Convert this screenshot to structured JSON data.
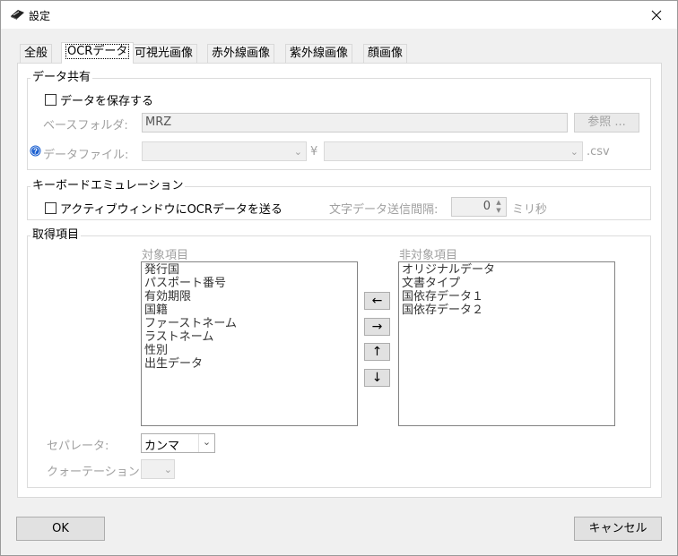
{
  "window": {
    "title": "設定"
  },
  "tabs": [
    "全般",
    "OCRデータ",
    "可視光画像",
    "赤外線画像",
    "紫外線画像",
    "顔画像"
  ],
  "data_share": {
    "group_title": "データ共有",
    "save_checkbox_label": "データを保存する",
    "save_checked": false,
    "base_folder_label": "ベースフォルダ:",
    "base_folder_value": "MRZ",
    "browse_button": "参照 ...",
    "data_file_label": "データファイル:",
    "separator_symbol": "¥",
    "extension": ".csv"
  },
  "keyboard": {
    "group_title": "キーボードエミュレーション",
    "send_checkbox_label": "アクティブウィンドウにOCRデータを送る",
    "send_checked": false,
    "interval_label": "文字データ送信間隔:",
    "interval_value": "0",
    "interval_unit": "ミリ秒"
  },
  "items": {
    "group_title": "取得項目",
    "target_label": "対象項目",
    "nontarget_label": "非対象項目",
    "target_items": [
      "発行国",
      "パスポート番号",
      "有効期限",
      "国籍",
      "ファーストネーム",
      "ラストネーム",
      "性別",
      "出生データ"
    ],
    "nontarget_items": [
      "オリジナルデータ",
      "文書タイプ",
      "国依存データ１",
      "国依存データ２"
    ],
    "move_left": "←",
    "move_right": "→",
    "move_up": "↑",
    "move_down": "↓",
    "separator_label": "セパレータ:",
    "separator_value": "カンマ",
    "quotation_label": "クォーテーション:"
  },
  "footer": {
    "ok": "OK",
    "cancel": "キャンセル"
  }
}
